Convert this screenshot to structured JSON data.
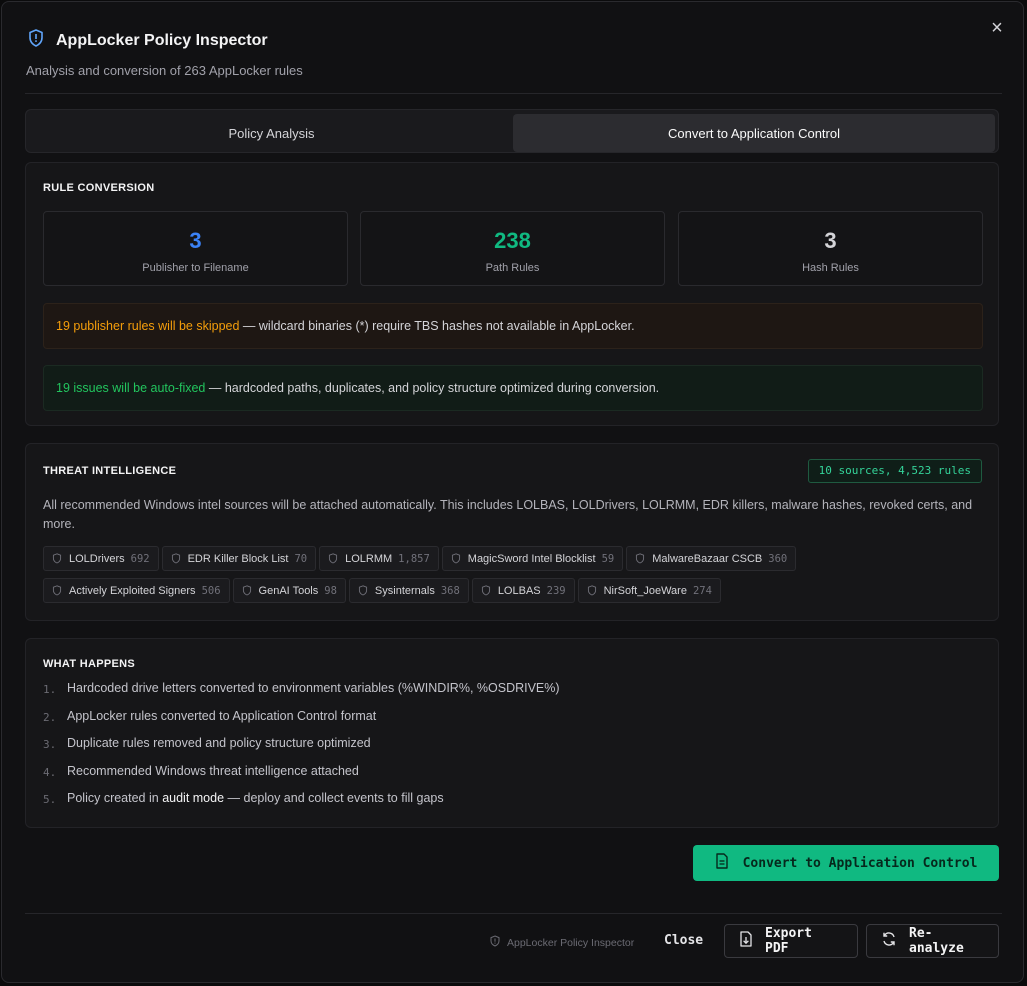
{
  "dialog": {
    "title": "AppLocker Policy Inspector",
    "subtitle": "Analysis and conversion of 263 AppLocker rules",
    "close_icon": "×"
  },
  "tabs": [
    {
      "label": "Policy Analysis",
      "active": false
    },
    {
      "label": "Convert to Application Control",
      "active": true
    }
  ],
  "rule_conversion": {
    "heading": "RULE CONVERSION",
    "stats": [
      {
        "value": "3",
        "label": "Publisher to Filename",
        "color": "#3b82f6"
      },
      {
        "value": "238",
        "label": "Path Rules",
        "color": "#10b981"
      },
      {
        "value": "3",
        "label": "Hash Rules",
        "color": "#d4d4d8"
      }
    ],
    "warning": {
      "highlight": "19 publisher rules will be skipped",
      "text": " — wildcard binaries (*) require TBS hashes not available in AppLocker."
    },
    "success": {
      "highlight": "19 issues will be auto-fixed",
      "text": " — hardcoded paths, duplicates, and policy structure optimized during conversion."
    }
  },
  "threat_intel": {
    "heading": "THREAT INTELLIGENCE",
    "badge": "10 sources, 4,523 rules",
    "description": "All recommended Windows intel sources will be attached automatically. This includes LOLBAS, LOLDrivers, LOLRMM, EDR killers, malware hashes, revoked certs, and more.",
    "sources": [
      {
        "name": "LOLDrivers",
        "count": "692"
      },
      {
        "name": "EDR Killer Block List",
        "count": "70"
      },
      {
        "name": "LOLRMM",
        "count": "1,857"
      },
      {
        "name": "MagicSword Intel Blocklist",
        "count": "59"
      },
      {
        "name": "MalwareBazaar CSCB",
        "count": "360"
      },
      {
        "name": "Actively Exploited Signers",
        "count": "506"
      },
      {
        "name": "GenAI Tools",
        "count": "98"
      },
      {
        "name": "Sysinternals",
        "count": "368"
      },
      {
        "name": "LOLBAS",
        "count": "239"
      },
      {
        "name": "NirSoft_JoeWare",
        "count": "274"
      }
    ]
  },
  "what_happens": {
    "heading": "WHAT HAPPENS",
    "steps": [
      {
        "n": "1.",
        "text": "Hardcoded drive letters converted to environment variables (%WINDIR%, %OSDRIVE%)"
      },
      {
        "n": "2.",
        "text": "AppLocker rules converted to Application Control format"
      },
      {
        "n": "3.",
        "text": "Duplicate rules removed and policy structure optimized"
      },
      {
        "n": "4.",
        "text": "Recommended Windows threat intelligence attached"
      },
      {
        "n": "5.",
        "pre": "Policy created in ",
        "em": "audit mode",
        "post": " — deploy and collect events to fill gaps"
      }
    ]
  },
  "actions": {
    "convert_label": "Convert to Application Control",
    "footer_note": "AppLocker Policy Inspector",
    "close_label": "Close",
    "export_label": "Export PDF",
    "reanalyze_label": "Re-analyze"
  },
  "colors": {
    "accent": "#10b981",
    "warning": "#f59e0b",
    "success": "#22c55e",
    "blue": "#3b82f6"
  }
}
